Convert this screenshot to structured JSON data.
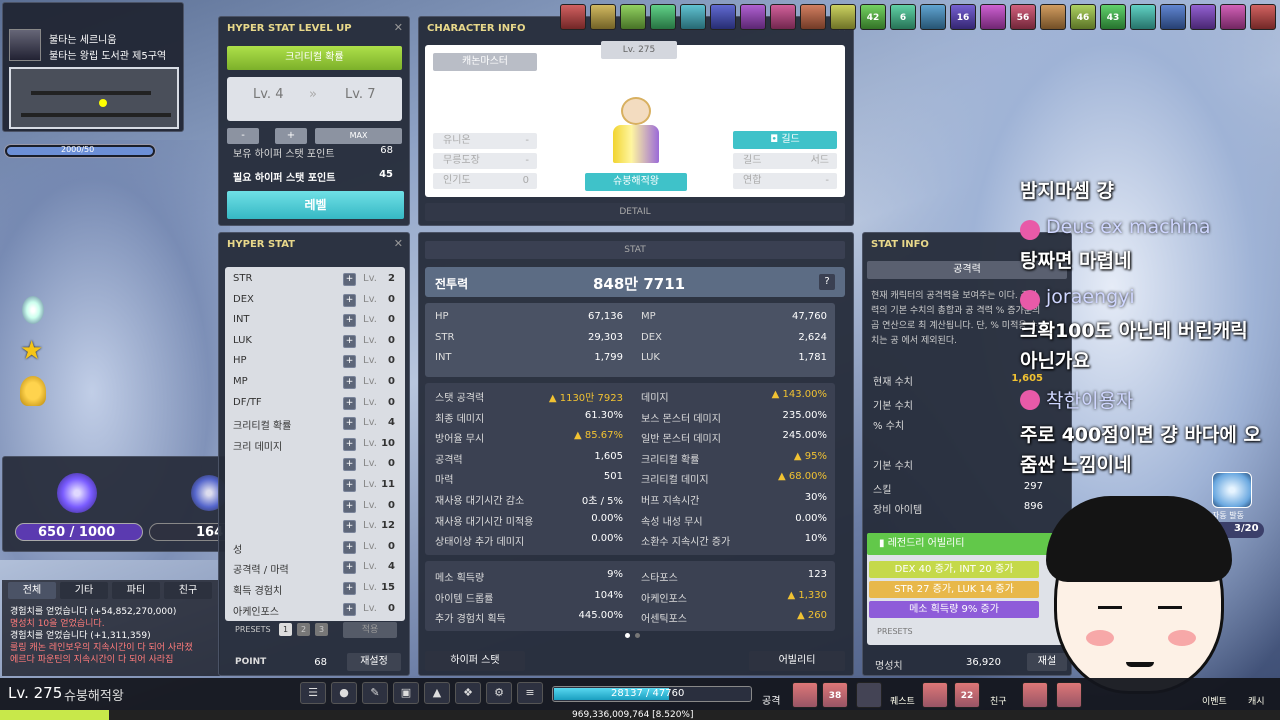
{
  "map": {
    "line1": "불타는 세르니움",
    "line2": "불타는 왕립 도서관 제5구역",
    "exp_bar_text": "2000/50"
  },
  "hyper_levelup": {
    "title": "HYPER STAT LEVEL UP",
    "stat_name": "크리티컬 확률",
    "lv_from": "Lv. 4",
    "lv_to": "Lv. 7",
    "arrows": "»",
    "minus": "-",
    "plus": "+",
    "max": "MAX",
    "owned_label": "보유 하이퍼 스탯 포인트",
    "owned_value": "68",
    "need_label": "필요 하이퍼 스탯 포인트",
    "need_value": "45",
    "levelup_button": "레벨"
  },
  "hyper_stat": {
    "title": "HYPER STAT",
    "lv_prefix": "Lv.",
    "rows": [
      {
        "name": "STR",
        "lv": "2"
      },
      {
        "name": "DEX",
        "lv": "0"
      },
      {
        "name": "INT",
        "lv": "0"
      },
      {
        "name": "LUK",
        "lv": "0"
      },
      {
        "name": "HP",
        "lv": "0"
      },
      {
        "name": "MP",
        "lv": "0"
      },
      {
        "name": "DF/TF",
        "lv": "0"
      },
      {
        "name": "크리티컬 확률",
        "lv": "4"
      },
      {
        "name": "크리 데미지",
        "lv": "10"
      },
      {
        "name": "",
        "lv": "0"
      },
      {
        "name": "",
        "lv": "11"
      },
      {
        "name": "",
        "lv": "0"
      },
      {
        "name": "",
        "lv": "12"
      },
      {
        "name": "성",
        "lv": "0"
      },
      {
        "name": "공격력 / 마력",
        "lv": "4"
      },
      {
        "name": "획득 경험치",
        "lv": "15"
      },
      {
        "name": "아케인포스",
        "lv": "0"
      }
    ],
    "presets_label": "PRESETS",
    "presets": [
      "1",
      "2",
      "3"
    ],
    "apply": "적용",
    "point_label": "POINT",
    "point_value": "68",
    "reset": "재설정"
  },
  "gauge_popup": {
    "left_value": "650 / 1000",
    "right_value": "164",
    "close": "✕"
  },
  "chat_log": {
    "tabs": [
      "전체",
      "기타",
      "파티",
      "친구"
    ],
    "lines": [
      {
        "text": "경험치를 얻었습니다 (+54,852,270,000)",
        "color": "#ffffff"
      },
      {
        "text": "명성치 10을 얻었습니다.",
        "color": "#ff7b7b"
      },
      {
        "text": "경험치를 얻었습니다 (+1,311,359)",
        "color": "#ffffff"
      },
      {
        "text": "룰링 캐논 레인보우의 지속시간이 다 되어 사라졌",
        "color": "#ff7b7b"
      },
      {
        "text": "에르다 파운틴의 지속시간이 다 되어 사라집",
        "color": "#ff7b7b"
      }
    ]
  },
  "char_info": {
    "title": "CHARACTER INFO",
    "level": "Lv. 275",
    "job": "캐논마스터",
    "union_label": "유니온",
    "union_value": "-",
    "mureung_label": "무릉도장",
    "mureung_value": "-",
    "pop_label": "인기도",
    "pop_value": "0",
    "guild_button": "길드",
    "guild_label": "길드",
    "guild_value": "서드",
    "alliance_label": "연합",
    "alliance_value": "-",
    "name": "슈붕해적왕",
    "detail": "DETAIL"
  },
  "stat": {
    "title": "STAT",
    "power_label": "전투력",
    "power_value": "848만 7711",
    "help": "?",
    "base": [
      {
        "l": "HP",
        "lv": "67,136",
        "r": "MP",
        "rv": "47,760"
      },
      {
        "l": "STR",
        "lv": "29,303",
        "r": "DEX",
        "rv": "2,624"
      },
      {
        "l": "INT",
        "lv": "1,799",
        "r": "LUK",
        "rv": "1,781"
      }
    ],
    "detail": [
      {
        "l": "스탯 공격력",
        "lv": "▲ 1130만 7923",
        "lgold": true,
        "r": "데미지",
        "rv": "▲ 143.00%",
        "rgold": true
      },
      {
        "l": "최종 데미지",
        "lv": "61.30%",
        "r": "보스 몬스터 데미지",
        "rv": "235.00%"
      },
      {
        "l": "방어율 무시",
        "lv": "▲ 85.67%",
        "lgold": true,
        "r": "일반 몬스터 데미지",
        "rv": "245.00%"
      },
      {
        "l": "공격력",
        "lv": "1,605",
        "r": "크리티컬 확률",
        "rv": "▲ 95%",
        "rgold": true
      },
      {
        "l": "마력",
        "lv": "501",
        "r": "크리티컬 데미지",
        "rv": "▲ 68.00%",
        "rgold": true
      },
      {
        "l": "재사용 대기시간 감소",
        "lv": "0초 / 5%",
        "r": "버프 지속시간",
        "rv": "30%"
      },
      {
        "l": "재사용 대기시간 미적용",
        "lv": "0.00%",
        "r": "속성 내성 무시",
        "rv": "0.00%"
      },
      {
        "l": "상태이상 추가 데미지",
        "lv": "0.00%",
        "r": "소환수 지속시간 증가",
        "rv": "10%"
      }
    ],
    "misc": [
      {
        "l": "메소 획득량",
        "lv": "9%",
        "r": "스타포스",
        "rv": "123"
      },
      {
        "l": "아이템 드롭률",
        "lv": "104%",
        "r": "아케인포스",
        "rv": "▲ 1,330",
        "rgold": true
      },
      {
        "l": "추가 경험치 획득",
        "lv": "445.00%",
        "r": "어센틱포스",
        "rv": "▲ 260",
        "rgold": true
      }
    ],
    "hyper_button": "하이퍼 스탯",
    "ability_button": "어빌리티"
  },
  "stat_info": {
    "title": "STAT INFO",
    "subject": "공격력",
    "desc": "현재 캐릭터의 공격력을 보여주는 이다. 공격력의 기본 수치의 총합과 공 격력 % 증가분의 곱 연산으로 최 계산됩니다. 단, % 미적용 수치는 공 에서 제외된다.",
    "rows": [
      {
        "l": "현재 수치",
        "v": "1,605"
      },
      {
        "l": "기본 수치",
        "v": ""
      },
      {
        "l": "% 수치",
        "v": ""
      },
      {
        "l": "기본 수치",
        "v": ""
      },
      {
        "l": "스킬",
        "v": "297"
      },
      {
        "l": "장비 아이템",
        "v": "896"
      }
    ],
    "legend_title": "레전드리 어빌리티",
    "abilities": [
      "DEX 40 증가, INT 20 증가",
      "STR 27 증가, LUK 14 증가",
      "메소 획득량 9% 증가"
    ],
    "presets_label": "PRESETS",
    "fame_label": "명성치",
    "fame_value": "36,920",
    "reset": "재설"
  },
  "stream_chat": [
    {
      "type": "msg",
      "text": "밤지마셈 걍"
    },
    {
      "type": "name",
      "text": "Deus ex machina"
    },
    {
      "type": "msg",
      "text": "탕짜면 마렵네"
    },
    {
      "type": "name",
      "text": "joraengyi"
    },
    {
      "type": "msg",
      "text": "크확100도 아닌데 버린캐릭"
    },
    {
      "type": "msg",
      "text": "아닌가요"
    },
    {
      "type": "name",
      "text": "착한이용자"
    },
    {
      "type": "msg",
      "text": "주로 400점이면 걍 바다에 오"
    },
    {
      "type": "msg",
      "text": "줌싼 느낌이네"
    }
  ],
  "top_icons": [
    "42",
    "6",
    "16",
    "56",
    "46",
    "43"
  ],
  "quest_counter": "3/20",
  "auto_label": "자동 발동",
  "bottom": {
    "level": "Lv. 275",
    "name": "슈붕해적왕",
    "hp_text": "28137 / 47760",
    "exp_text": "969,336,009,764 [8.520%]",
    "menu_label": "메뉴",
    "attack_label": "공격",
    "quick_numbers": [
      "38",
      "22"
    ],
    "right_labels": [
      "퀘스트",
      "친구",
      "이벤트",
      "캐시"
    ]
  },
  "colors": {
    "gold": "#f1c232",
    "green_bar": "#9ccc3c",
    "teal": "#3fc2c9",
    "purple_bar": "#8e5cd9"
  }
}
